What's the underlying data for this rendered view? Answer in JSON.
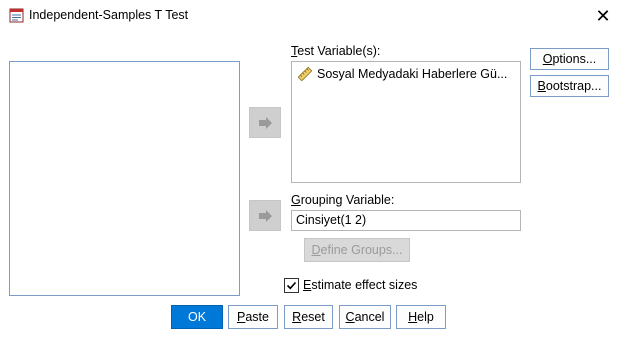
{
  "window": {
    "title": "Independent-Samples T Test",
    "close_glyph": "✕",
    "app_icon": "spss-dialog-icon"
  },
  "test_variables": {
    "label_first": "T",
    "label_rest": "est Variable(s):",
    "items": [
      {
        "label": "Sosyal Medyadaki Haberlere Gü...",
        "icon": "scale-ruler-icon"
      }
    ]
  },
  "grouping": {
    "label_first": "G",
    "label_rest": "rouping Variable:",
    "value": "Cinsiyet(1 2)"
  },
  "define_groups": {
    "label_first": "D",
    "label_rest": "efine Groups..."
  },
  "side_buttons": {
    "options_first": "O",
    "options_rest": "ptions...",
    "bootstrap_first": "B",
    "bootstrap_rest": "ootstrap..."
  },
  "estimate_effect": {
    "label_first": "E",
    "label_rest": "stimate effect sizes",
    "checked": true
  },
  "footer": {
    "ok": "OK",
    "paste_first": "P",
    "paste_rest": "aste",
    "reset_first": "R",
    "reset_rest": "eset",
    "cancel_first": "C",
    "cancel_rest": "ancel",
    "help_first": "H",
    "help_rest": "elp"
  },
  "colors": {
    "accent": "#0078d7",
    "list_border": "#7a9cc7",
    "arrow_button": "#cfcfcf"
  }
}
